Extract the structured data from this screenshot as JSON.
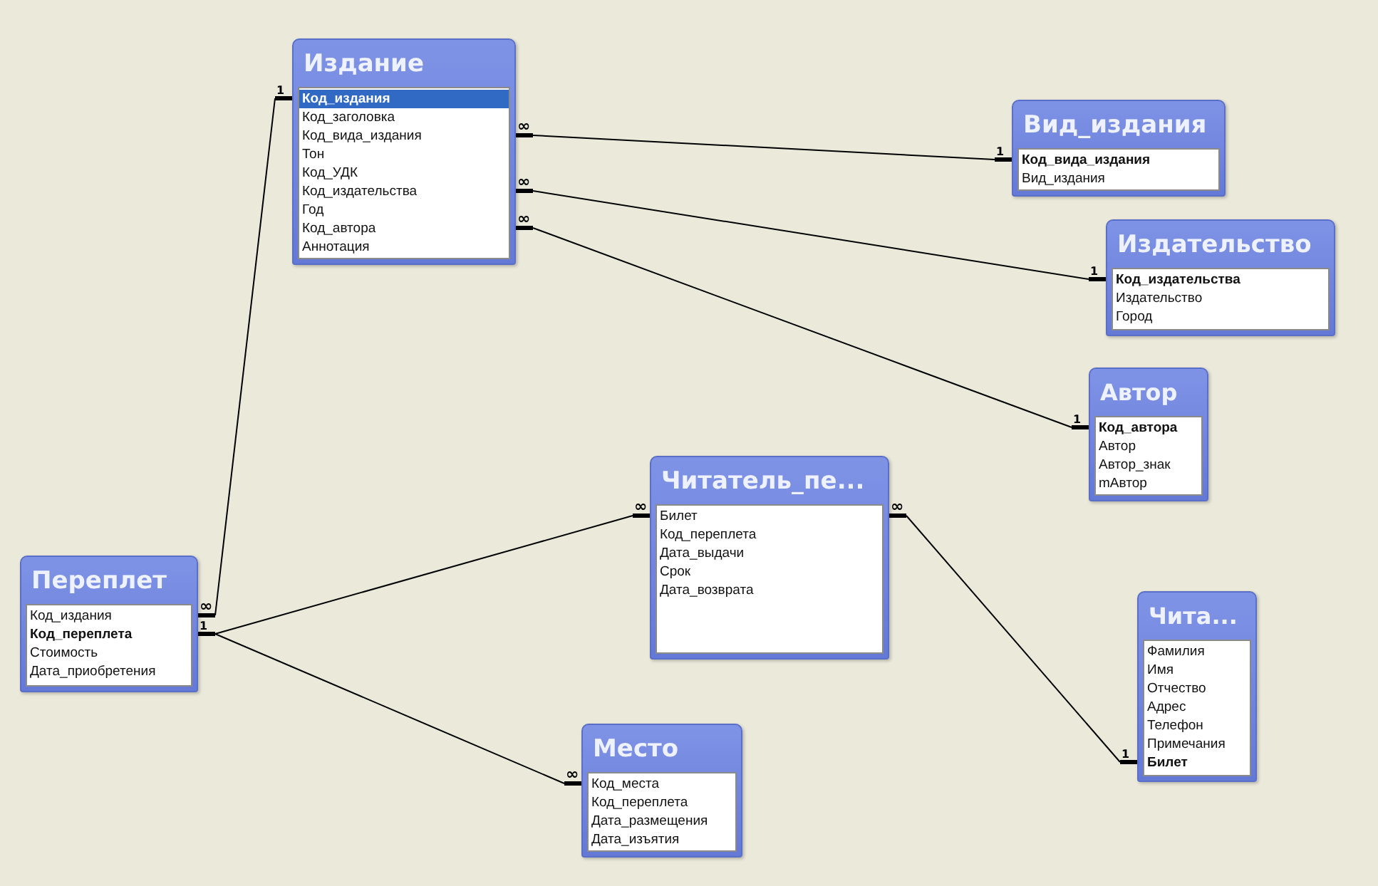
{
  "tables": [
    {
      "title": "Издание",
      "fields": [
        {
          "name": "Код_издания",
          "primary_key": true,
          "selected": true
        },
        {
          "name": "Код_заголовка",
          "primary_key": false,
          "selected": false
        },
        {
          "name": "Код_вида_издания",
          "primary_key": false,
          "selected": false
        },
        {
          "name": "Тон",
          "primary_key": false,
          "selected": false
        },
        {
          "name": "Код_УДК",
          "primary_key": false,
          "selected": false
        },
        {
          "name": "Код_издательства",
          "primary_key": false,
          "selected": false
        },
        {
          "name": "Год",
          "primary_key": false,
          "selected": false
        },
        {
          "name": "Код_автора",
          "primary_key": false,
          "selected": false
        },
        {
          "name": "Аннотация",
          "primary_key": false,
          "selected": false
        }
      ]
    },
    {
      "title": "Вид_издания",
      "fields": [
        {
          "name": "Код_вида_издания",
          "primary_key": true,
          "selected": false
        },
        {
          "name": "Вид_издания",
          "primary_key": false,
          "selected": false
        }
      ]
    },
    {
      "title": "Издательство",
      "fields": [
        {
          "name": "Код_издательства",
          "primary_key": true,
          "selected": false
        },
        {
          "name": "Издательство",
          "primary_key": false,
          "selected": false
        },
        {
          "name": "Город",
          "primary_key": false,
          "selected": false
        }
      ]
    },
    {
      "title": "Автор",
      "fields": [
        {
          "name": "Код_автора",
          "primary_key": true,
          "selected": false
        },
        {
          "name": "Автор",
          "primary_key": false,
          "selected": false
        },
        {
          "name": "Автор_знак",
          "primary_key": false,
          "selected": false
        },
        {
          "name": "mАвтор",
          "primary_key": false,
          "selected": false
        }
      ]
    },
    {
      "title": "Читатель_пе...",
      "fields": [
        {
          "name": "Билет",
          "primary_key": false,
          "selected": false
        },
        {
          "name": "Код_переплета",
          "primary_key": false,
          "selected": false
        },
        {
          "name": "Дата_выдачи",
          "primary_key": false,
          "selected": false
        },
        {
          "name": "Срок",
          "primary_key": false,
          "selected": false
        },
        {
          "name": "Дата_возврата",
          "primary_key": false,
          "selected": false
        }
      ]
    },
    {
      "title": "Чита...",
      "fields": [
        {
          "name": "Фамилия",
          "primary_key": false,
          "selected": false
        },
        {
          "name": "Имя",
          "primary_key": false,
          "selected": false
        },
        {
          "name": "Отчество",
          "primary_key": false,
          "selected": false
        },
        {
          "name": "Адрес",
          "primary_key": false,
          "selected": false
        },
        {
          "name": "Телефон",
          "primary_key": false,
          "selected": false
        },
        {
          "name": "Примечания",
          "primary_key": false,
          "selected": false
        },
        {
          "name": "Билет",
          "primary_key": true,
          "selected": false
        }
      ]
    },
    {
      "title": "Переплет",
      "fields": [
        {
          "name": "Код_издания",
          "primary_key": false,
          "selected": false
        },
        {
          "name": "Код_переплета",
          "primary_key": true,
          "selected": false
        },
        {
          "name": "Стоимость",
          "primary_key": false,
          "selected": false
        },
        {
          "name": "Дата_приобретения",
          "primary_key": false,
          "selected": false
        }
      ]
    },
    {
      "title": "Место",
      "fields": [
        {
          "name": "Код_места",
          "primary_key": false,
          "selected": false
        },
        {
          "name": "Код_переплета",
          "primary_key": false,
          "selected": false
        },
        {
          "name": "Дата_размещения",
          "primary_key": false,
          "selected": false
        },
        {
          "name": "Дата_изъятия",
          "primary_key": false,
          "selected": false
        }
      ]
    }
  ],
  "relationships": [
    {
      "start_label": "1",
      "end_label": "∞"
    },
    {
      "start_label": "∞",
      "end_label": "1"
    },
    {
      "start_label": "∞",
      "end_label": "1"
    },
    {
      "start_label": "∞",
      "end_label": "1"
    },
    {
      "start_label": "1",
      "branches": [
        {
          "end_label": "∞"
        },
        {
          "end_label": "∞"
        }
      ]
    },
    {
      "start_label": "∞",
      "end_label": "1"
    }
  ]
}
